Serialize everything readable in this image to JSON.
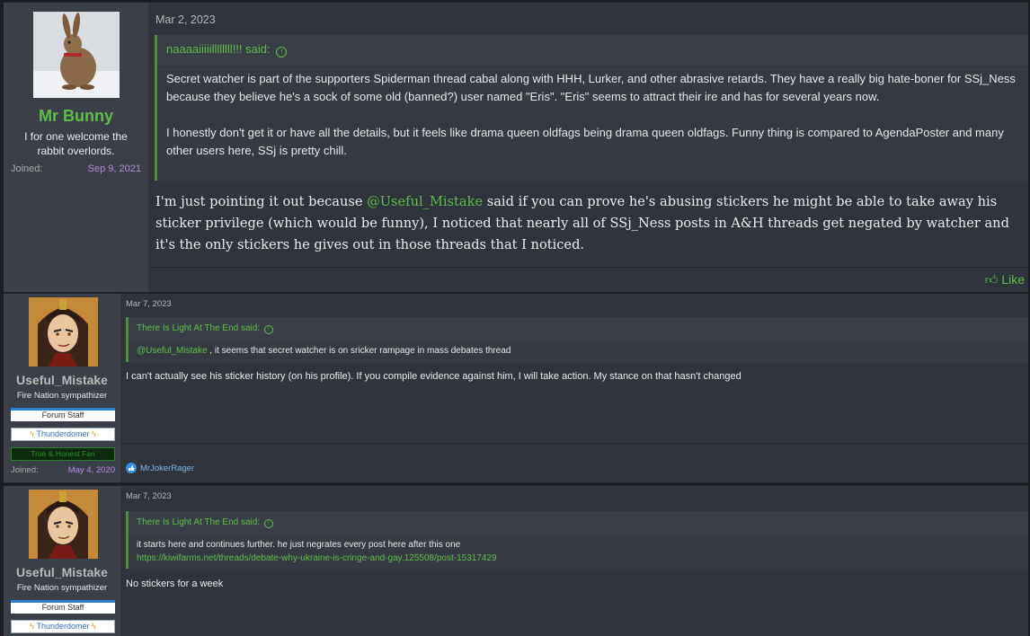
{
  "posts": [
    {
      "author": "Mr Bunny",
      "user_title": "I for one welcome the rabbit overlords.",
      "joined_label": "Joined:",
      "joined_date": "Sep 9, 2021",
      "date": "Mar 2, 2023",
      "quote_author": "naaaaiiiiillllllll!!! said:",
      "quote_p1": "Secret watcher is part of the supporters Spiderman thread cabal along with HHH, Lurker, and other abrasive retards. They have a really big hate-boner for SSj_Ness because they believe he's a sock of some old (banned?) user named \"Eris\". \"Eris\" seems to attract their ire and has for several years now.",
      "quote_p2": "I honestly don't get it or have all the details, but it feels like drama queen oldfags being drama queen oldfags. Funny thing is compared to AgendaPoster and many other users here, SSj is pretty chill.",
      "msg_before": "I'm just pointing it out because ",
      "msg_mention": "@Useful_Mistake",
      "msg_after": " said if you can prove he's abusing stickers he might be able to take away his sticker privilege (which would be funny), I noticed that nearly all of SSj_Ness posts in A&H threads get negated by watcher and it's the only stickers he gives out in those threads that I noticed.",
      "like_label": "Like"
    },
    {
      "author": "Useful_Mistake",
      "user_title": "Fire Nation sympathizer",
      "badge_staff": "Forum Staff",
      "badge_thunder": "Thunderdomer",
      "badge_green": "True & Honest Fan",
      "joined_label": "Joined:",
      "joined_date": "May 4, 2020",
      "date": "Mar 7, 2023",
      "quote_author": "There Is Light At The End said:",
      "quote_mention": "@Useful_Mistake",
      "quote_text": " , it seems that secret watcher is on sricker rampage in mass debates thread",
      "message": "I can't actually see his sticker history (on his profile). If you compile evidence against him, I will take action. My stance on that hasn't changed",
      "reaction_user": "MrJokerRager"
    },
    {
      "author": "Useful_Mistake",
      "user_title": "Fire Nation sympathizer",
      "badge_staff": "Forum Staff",
      "badge_thunder": "Thunderdomer",
      "date": "Mar 7, 2023",
      "quote_author": "There Is Light At The End said:",
      "quote_text": "it starts here and continues further. he just negrates every post here after this one",
      "quote_link": "https://kiwifarms.net/threads/debate-why-ukraine-is-cringe-and-gay.125508/post-15317429",
      "message": "No stickers for a week"
    }
  ],
  "icons": {
    "quote_arrow": "arrow-up-circle-icon",
    "like": "thumbs-up-icon",
    "thunder": "lightning-icon",
    "reaction": "like-reaction-icon"
  },
  "colors": {
    "accent_green": "#5fbb4b",
    "joined_purple": "#b48ad8",
    "staff_blue": "#2d7fd3"
  }
}
